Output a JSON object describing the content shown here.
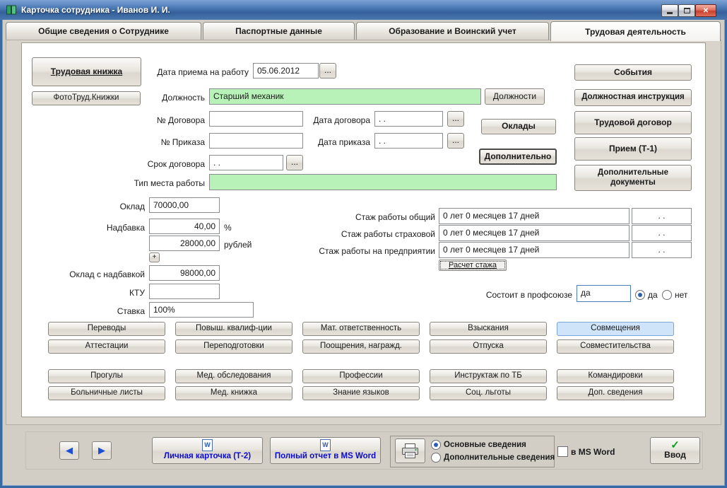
{
  "colors": {
    "titlebar_blue": "#3f6fae",
    "field_green": "#b9f2b9",
    "grid_active_blue": "#cfe4f8",
    "link_blue": "#0a0ad0",
    "check_green": "#0f9f1f"
  },
  "window": {
    "title": "Карточка сотрудника -  Иванов И. И."
  },
  "icons": {
    "close": "✕",
    "prev": "◀",
    "next": "▶",
    "check": "✓",
    "word": "W"
  },
  "tabs": {
    "general": "Общие сведения о Сотруднике",
    "passport": "Паспортные данные",
    "education": "Образование и Воинский учет",
    "labor": "Трудовая деятельность"
  },
  "form": {
    "work_book_btn": "Трудовая книжка",
    "photo_book_btn": "ФотоТруд.Книжки",
    "hire_date_label": "Дата приема на работу",
    "hire_date": "05.06.2012",
    "browse": "...",
    "position_label": "Должность",
    "position": "Старший механик",
    "positions_btn": "Должности",
    "contract_no_label": "№ Договора",
    "contract_date_label": "Дата договора",
    "contract_date": ". .",
    "order_no_label": "№ Приказа",
    "order_date_label": "Дата приказа",
    "order_date": ". .",
    "salaries_btn": "Оклады",
    "more_btn": "Дополнительно",
    "term_label": "Срок договора",
    "term": ". .",
    "workplace_label": "Тип места работы",
    "events_btn": "События",
    "job_instruction_btn": "Должностная инструкция",
    "labor_contract_btn": "Трудовой договор",
    "hire_t1_btn": "Прием (Т-1)",
    "add_docs_btn": "Дополнительные документы",
    "salary_label": "Оклад",
    "salary": "70000,00",
    "bonus_label": "Надбавка",
    "bonus_percent": "40,00",
    "percent_sign": "%",
    "bonus_rubles": "28000,00",
    "rubles_label": "рублей",
    "plus_btn": "+",
    "salary_total_label": "Оклад с надбавкой",
    "salary_total": "98000,00",
    "ktu_label": "КТУ",
    "rate_label": "Ставка",
    "rate": "100%",
    "union_label": "Состоит в профсоюзе",
    "union_value": "да",
    "union_yes": "да",
    "union_no": "нет"
  },
  "experience": {
    "rows": [
      {
        "label": "Стаж работы общий",
        "value": "0 лет 0 месяцев 17 дней",
        "date": ". ."
      },
      {
        "label": "Стаж работы страховой",
        "value": "0 лет 0 месяцев 17 дней",
        "date": ". ."
      },
      {
        "label": "Стаж работы на предприятии",
        "value": "0 лет 0 месяцев 17 дней",
        "date": ". ."
      }
    ],
    "calc_btn": "Расчет стажа"
  },
  "grid": {
    "active_button": "Совмещения",
    "rows": [
      [
        "Переводы",
        "Повыш. квалиф-ции",
        "Мат. ответственность",
        "Взыскания",
        "Совмещения"
      ],
      [
        "Аттестации",
        "Переподготовки",
        "Поощрения, награжд.",
        "Отпуска",
        "Совместительства"
      ],
      [
        "Прогулы",
        "Мед. обследования",
        "Профессии",
        "Инструктаж по ТБ",
        "Командировки"
      ],
      [
        "Больничные листы",
        "Мед. книжка",
        "Знание языков",
        "Соц. льготы",
        "Доп. сведения"
      ]
    ]
  },
  "footer": {
    "personal_card_btn": "Личная карточка (Т-2)",
    "full_report_btn": "Полный отчет в MS Word",
    "radio_main": "Основные сведения",
    "radio_additional": "Дополнительные сведения",
    "msword_checkbox": "в MS Word",
    "enter_btn": "Ввод"
  }
}
